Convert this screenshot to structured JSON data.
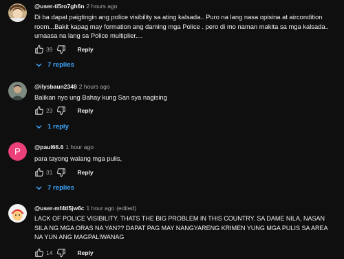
{
  "comments": [
    {
      "handle": "@user-ti5ro7gh6n",
      "time": "2 hours ago",
      "text": "Di ba dapat paigtingin ang police visibility sa ating kalsada.. Puro na lang nasa opisina at aircondition room...Bakit kapag may formation ang daming mga Police . pero di mo naman makita sa mga kalsada.. umaasa na lang sa Police multiplier....",
      "likes": "39",
      "reply_label": "Reply",
      "replies_label": "7 replies",
      "avatar_icon": "anime-character-avatar"
    },
    {
      "handle": "@ilysbaun2348",
      "time": "2 hours ago",
      "text": "Balikan nyo ung Bahay kung San sya nagising",
      "likes": "23",
      "reply_label": "Reply",
      "replies_label": "1 reply",
      "avatar_icon": "person-photo-avatar"
    },
    {
      "handle": "@paul66.6",
      "time": "1 hour ago",
      "text": "para tayong walang mga pulis,",
      "likes": "31",
      "reply_label": "Reply",
      "replies_label": "7 replies",
      "avatar_letter": "P",
      "avatar_color": "#ec407a"
    },
    {
      "handle": "@user-mf4tl5jw6c",
      "time": "1 hour ago",
      "edited": "(edited)",
      "text": "LACK OF POLICE VISIBILITY. THATS THE BIG PROBLEM IN THIS COUNTRY. SA DAME NILA, NASAN SILA NG MGA ORAS NA YAN?? DAPAT PAG MAY NANGYARENG KRIMEN YUNG MGA PULIS SA AREA NA YUN ANG MAGPALIWANAG",
      "likes": "14",
      "reply_label": "Reply",
      "avatar_icon": "cartoon-face-avatar"
    }
  ],
  "colors": {
    "background": "#0f0f0f",
    "text": "#f1f1f1",
    "muted": "#aaaaaa",
    "link": "#3ea6ff"
  }
}
